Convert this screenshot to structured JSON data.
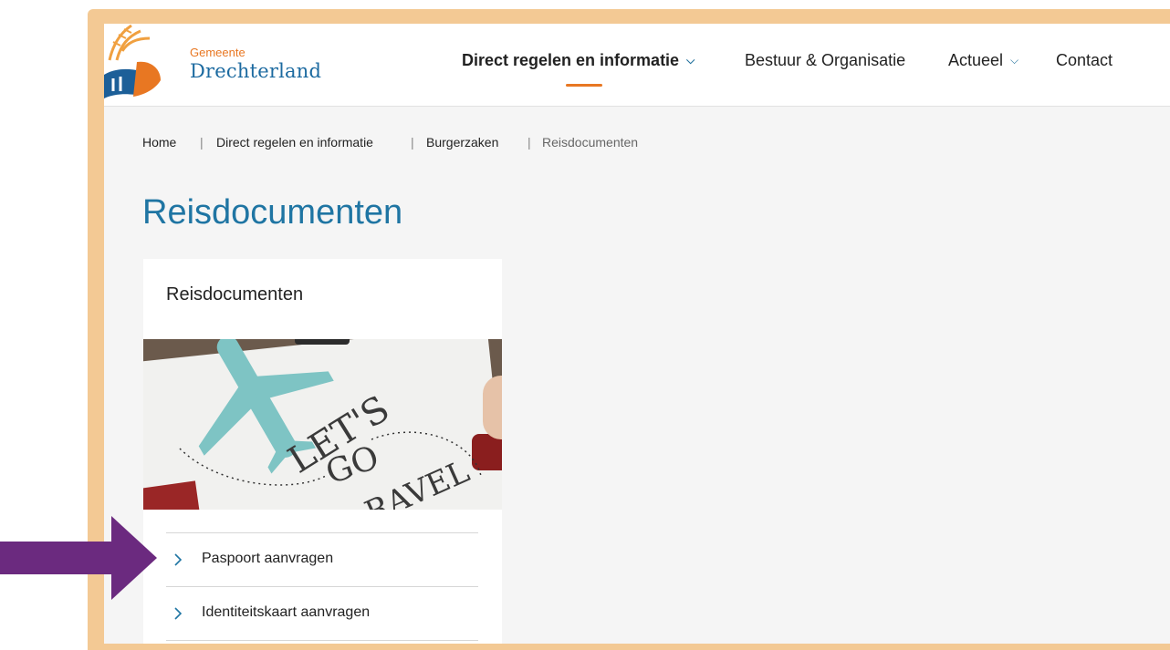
{
  "header": {
    "logo_small": "Gemeente",
    "logo_big": "Drechterland",
    "nav": [
      {
        "label": "Direct regelen en informatie",
        "has_dropdown": true,
        "active": true
      },
      {
        "label": "Bestuur & Organisatie",
        "has_dropdown": false
      },
      {
        "label": "Actueel",
        "has_dropdown": true
      },
      {
        "label": "Contact",
        "has_dropdown": false
      }
    ],
    "dropdown_icon": "chevron-down-icon"
  },
  "breadcrumb": {
    "items": [
      "Home",
      "Direct regelen en informatie",
      "Burgerzaken",
      "Reisdocumenten"
    ],
    "separator": "|"
  },
  "page_title": "Reisdocumenten",
  "card": {
    "title": "Reisdocumenten",
    "image_text": [
      "LET'S",
      "GO",
      "RAVEL"
    ],
    "links": [
      {
        "label": "Paspoort aanvragen",
        "icon": "chevron-right-icon"
      },
      {
        "label": "Identiteitskaart aanvragen",
        "icon": "chevron-right-icon"
      }
    ]
  },
  "colors": {
    "frame": "#f3c994",
    "accent_orange": "#e87722",
    "title_blue": "#1f75a3",
    "annotation_purple": "#6b2a7f"
  }
}
